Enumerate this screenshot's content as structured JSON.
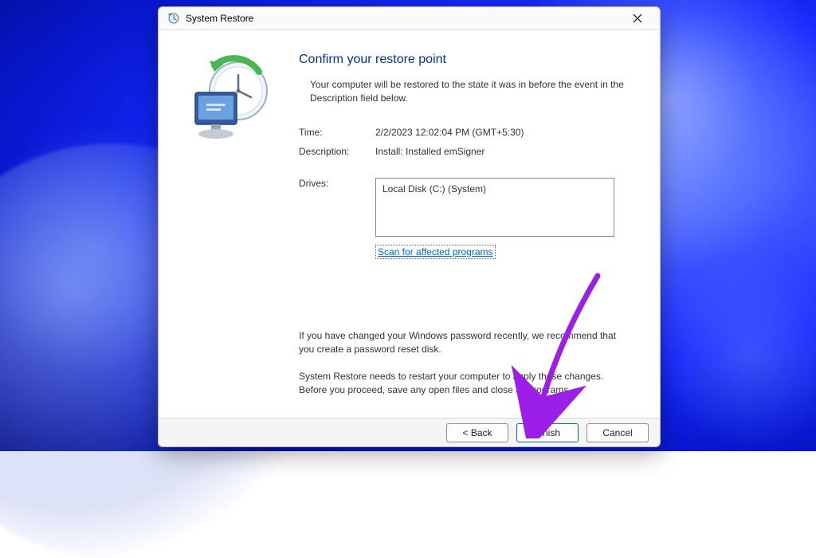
{
  "window": {
    "title": "System Restore"
  },
  "heading": "Confirm your restore point",
  "intro": "Your computer will be restored to the state it was in before the event in the Description field below.",
  "fields": {
    "time_label": "Time:",
    "time_value": "2/2/2023 12:02:04 PM (GMT+5:30)",
    "description_label": "Description:",
    "description_value": "Install: Installed emSigner",
    "drives_label": "Drives:",
    "drives_value": "Local Disk (C:) (System)"
  },
  "scan_link": "Scan for affected programs",
  "notes": {
    "password": "If you have changed your Windows password recently, we recommend that you create a password reset disk.",
    "restart": "System Restore needs to restart your computer to apply these changes. Before you proceed, save any open files and close all programs."
  },
  "buttons": {
    "back": "< Back",
    "finish": "Finish",
    "cancel": "Cancel"
  },
  "annotation": {
    "color": "#9c1fe8"
  }
}
